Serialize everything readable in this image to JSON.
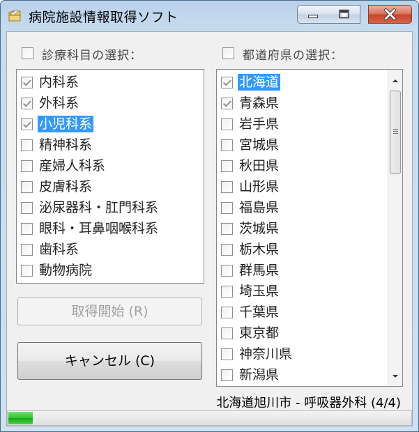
{
  "window": {
    "title": "病院施設情報取得ソフト"
  },
  "left_group": {
    "label": "診療科目の選択：",
    "select_all_checked": false,
    "items": [
      {
        "label": "内科系",
        "checked": true,
        "selected": false
      },
      {
        "label": "外科系",
        "checked": true,
        "selected": false
      },
      {
        "label": "小児科系",
        "checked": true,
        "selected": true
      },
      {
        "label": "精神科系",
        "checked": false,
        "selected": false
      },
      {
        "label": "産婦人科系",
        "checked": false,
        "selected": false
      },
      {
        "label": "皮膚科系",
        "checked": false,
        "selected": false
      },
      {
        "label": "泌尿器科・肛門科系",
        "checked": false,
        "selected": false
      },
      {
        "label": "眼科・耳鼻咽喉科系",
        "checked": false,
        "selected": false
      },
      {
        "label": "歯科系",
        "checked": false,
        "selected": false
      },
      {
        "label": "動物病院",
        "checked": false,
        "selected": false
      }
    ]
  },
  "right_group": {
    "label": "都道府県の選択：",
    "select_all_checked": false,
    "items": [
      {
        "label": "北海道",
        "checked": true,
        "selected": true
      },
      {
        "label": "青森県",
        "checked": true,
        "selected": false
      },
      {
        "label": "岩手県",
        "checked": false,
        "selected": false
      },
      {
        "label": "宮城県",
        "checked": false,
        "selected": false
      },
      {
        "label": "秋田県",
        "checked": false,
        "selected": false
      },
      {
        "label": "山形県",
        "checked": false,
        "selected": false
      },
      {
        "label": "福島県",
        "checked": false,
        "selected": false
      },
      {
        "label": "茨城県",
        "checked": false,
        "selected": false
      },
      {
        "label": "栃木県",
        "checked": false,
        "selected": false
      },
      {
        "label": "群馬県",
        "checked": false,
        "selected": false
      },
      {
        "label": "埼玉県",
        "checked": false,
        "selected": false
      },
      {
        "label": "千葉県",
        "checked": false,
        "selected": false
      },
      {
        "label": "東京都",
        "checked": false,
        "selected": false
      },
      {
        "label": "神奈川県",
        "checked": false,
        "selected": false
      },
      {
        "label": "新潟県",
        "checked": false,
        "selected": false
      }
    ]
  },
  "buttons": {
    "start_label": "取得開始 (R)",
    "cancel_label": "キャンセル (C)"
  },
  "status": {
    "text": "北海道旭川市 - 呼吸器外科 (4/4)"
  },
  "progress": {
    "fraction": 0.06
  },
  "colors": {
    "selection": "#3399ff",
    "progress": "#2fc22f",
    "close_button": "#c9452c"
  },
  "icons": {
    "app": "folder-icon",
    "minimize": "minimize-icon",
    "maximize": "maximize-icon",
    "close": "close-icon"
  }
}
